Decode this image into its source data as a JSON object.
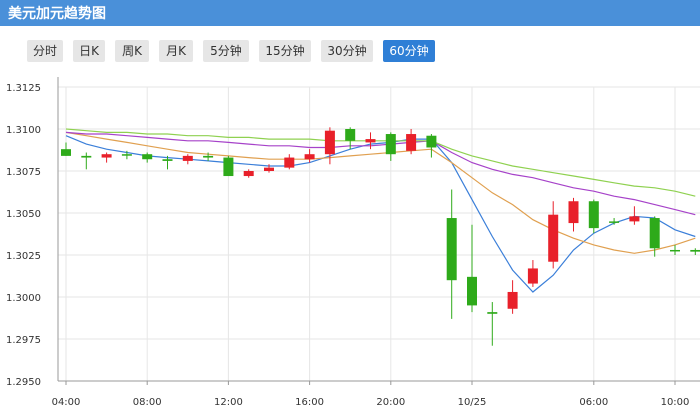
{
  "header": {
    "title": "美元加元趋势图"
  },
  "tabs": [
    {
      "label": "分时",
      "active": false
    },
    {
      "label": "日K",
      "active": false
    },
    {
      "label": "周K",
      "active": false
    },
    {
      "label": "月K",
      "active": false
    },
    {
      "label": "5分钟",
      "active": false
    },
    {
      "label": "15分钟",
      "active": false
    },
    {
      "label": "30分钟",
      "active": false
    },
    {
      "label": "60分钟",
      "active": true
    }
  ],
  "colors": {
    "header": "#4a90d9",
    "active_tab": "#2f7fd6",
    "up": "#e8202a",
    "down": "#2eaa1a",
    "ma5": "#3b7fd9",
    "ma10": "#e0a050",
    "ma20": "#a642c9",
    "ma30": "#8fd150"
  },
  "chart_data": {
    "type": "candlestick",
    "y_ticks": [
      "1.3125",
      "1.3100",
      "1.3075",
      "1.3050",
      "1.3025",
      "1.3000",
      "1.2975",
      "1.2950"
    ],
    "ylim": [
      1.295,
      1.3125
    ],
    "x_ticks": [
      "04:00",
      "08:00",
      "12:00",
      "16:00",
      "20:00",
      "10/25",
      "06:00",
      "10:00"
    ],
    "grid": true,
    "candles": [
      {
        "o": 1.3088,
        "h": 1.3092,
        "l": 1.3084,
        "c": 1.3084
      },
      {
        "o": 1.3084,
        "h": 1.3086,
        "l": 1.3076,
        "c": 1.3083
      },
      {
        "o": 1.3083,
        "h": 1.3086,
        "l": 1.308,
        "c": 1.3085
      },
      {
        "o": 1.3085,
        "h": 1.3087,
        "l": 1.3082,
        "c": 1.3085
      },
      {
        "o": 1.3085,
        "h": 1.3086,
        "l": 1.308,
        "c": 1.3082
      },
      {
        "o": 1.3082,
        "h": 1.3084,
        "l": 1.3076,
        "c": 1.3081
      },
      {
        "o": 1.3081,
        "h": 1.3085,
        "l": 1.3079,
        "c": 1.3084
      },
      {
        "o": 1.3084,
        "h": 1.3086,
        "l": 1.3081,
        "c": 1.3083
      },
      {
        "o": 1.3083,
        "h": 1.3084,
        "l": 1.3072,
        "c": 1.3072
      },
      {
        "o": 1.3072,
        "h": 1.3076,
        "l": 1.3071,
        "c": 1.3075
      },
      {
        "o": 1.3075,
        "h": 1.3079,
        "l": 1.3074,
        "c": 1.3077
      },
      {
        "o": 1.3077,
        "h": 1.3085,
        "l": 1.3076,
        "c": 1.3083
      },
      {
        "o": 1.3082,
        "h": 1.3088,
        "l": 1.308,
        "c": 1.3085
      },
      {
        "o": 1.3085,
        "h": 1.3101,
        "l": 1.3079,
        "c": 1.3099
      },
      {
        "o": 1.31,
        "h": 1.3101,
        "l": 1.3088,
        "c": 1.3093
      },
      {
        "o": 1.3092,
        "h": 1.3098,
        "l": 1.3088,
        "c": 1.3094
      },
      {
        "o": 1.3097,
        "h": 1.3098,
        "l": 1.3081,
        "c": 1.3085
      },
      {
        "o": 1.3087,
        "h": 1.31,
        "l": 1.3085,
        "c": 1.3097
      },
      {
        "o": 1.3096,
        "h": 1.3097,
        "l": 1.3083,
        "c": 1.3089
      },
      {
        "o": 1.3047,
        "h": 1.3064,
        "l": 1.2987,
        "c": 1.301
      },
      {
        "o": 1.3012,
        "h": 1.3043,
        "l": 1.2991,
        "c": 1.2995
      },
      {
        "o": 1.2991,
        "h": 1.2997,
        "l": 1.2971,
        "c": 1.299
      },
      {
        "o": 1.2993,
        "h": 1.301,
        "l": 1.299,
        "c": 1.3003
      },
      {
        "o": 1.3008,
        "h": 1.3022,
        "l": 1.3006,
        "c": 1.3017
      },
      {
        "o": 1.3021,
        "h": 1.3057,
        "l": 1.3017,
        "c": 1.3049
      },
      {
        "o": 1.3044,
        "h": 1.3059,
        "l": 1.3039,
        "c": 1.3057
      },
      {
        "o": 1.3057,
        "h": 1.3058,
        "l": 1.3038,
        "c": 1.3041
      },
      {
        "o": 1.3045,
        "h": 1.3047,
        "l": 1.3043,
        "c": 1.3045
      },
      {
        "o": 1.3045,
        "h": 1.3054,
        "l": 1.3043,
        "c": 1.3048
      },
      {
        "o": 1.3047,
        "h": 1.3048,
        "l": 1.3024,
        "c": 1.3029
      },
      {
        "o": 1.3028,
        "h": 1.3031,
        "l": 1.3025,
        "c": 1.3028
      },
      {
        "o": 1.3028,
        "h": 1.3029,
        "l": 1.3025,
        "c": 1.3027
      }
    ],
    "series": [
      {
        "key": "ma5",
        "values": [
          1.3096,
          1.3091,
          1.3088,
          1.3086,
          1.3084,
          1.3083,
          1.3082,
          1.3081,
          1.308,
          1.3079,
          1.3078,
          1.3078,
          1.308,
          1.3084,
          1.3088,
          1.3091,
          1.3092,
          1.3094,
          1.3094,
          1.308,
          1.3058,
          1.3036,
          1.3016,
          1.3003,
          1.3013,
          1.3028,
          1.3038,
          1.3044,
          1.3048,
          1.3047,
          1.304,
          1.3036
        ]
      },
      {
        "key": "ma10",
        "values": [
          1.3098,
          1.3096,
          1.3094,
          1.3092,
          1.309,
          1.3088,
          1.3086,
          1.3085,
          1.3084,
          1.3083,
          1.3082,
          1.3082,
          1.3082,
          1.3083,
          1.3084,
          1.3085,
          1.3086,
          1.3087,
          1.3088,
          1.308,
          1.3071,
          1.3062,
          1.3055,
          1.3046,
          1.304,
          1.3035,
          1.3031,
          1.3028,
          1.3026,
          1.3028,
          1.3031,
          1.3035
        ]
      },
      {
        "key": "ma20",
        "values": [
          1.3098,
          1.3097,
          1.3097,
          1.3096,
          1.3095,
          1.3094,
          1.3093,
          1.3093,
          1.3092,
          1.3091,
          1.309,
          1.309,
          1.3089,
          1.3089,
          1.309,
          1.309,
          1.3091,
          1.3092,
          1.3093,
          1.3086,
          1.308,
          1.3076,
          1.3073,
          1.3071,
          1.3068,
          1.3065,
          1.3063,
          1.306,
          1.3058,
          1.3055,
          1.3052,
          1.3049
        ]
      },
      {
        "key": "ma30",
        "values": [
          1.31,
          1.3099,
          1.3098,
          1.3098,
          1.3097,
          1.3097,
          1.3096,
          1.3096,
          1.3095,
          1.3095,
          1.3094,
          1.3094,
          1.3094,
          1.3093,
          1.3093,
          1.3093,
          1.3093,
          1.3093,
          1.3093,
          1.3088,
          1.3084,
          1.3081,
          1.3078,
          1.3076,
          1.3074,
          1.3072,
          1.307,
          1.3068,
          1.3066,
          1.3065,
          1.3063,
          1.306
        ]
      }
    ]
  }
}
